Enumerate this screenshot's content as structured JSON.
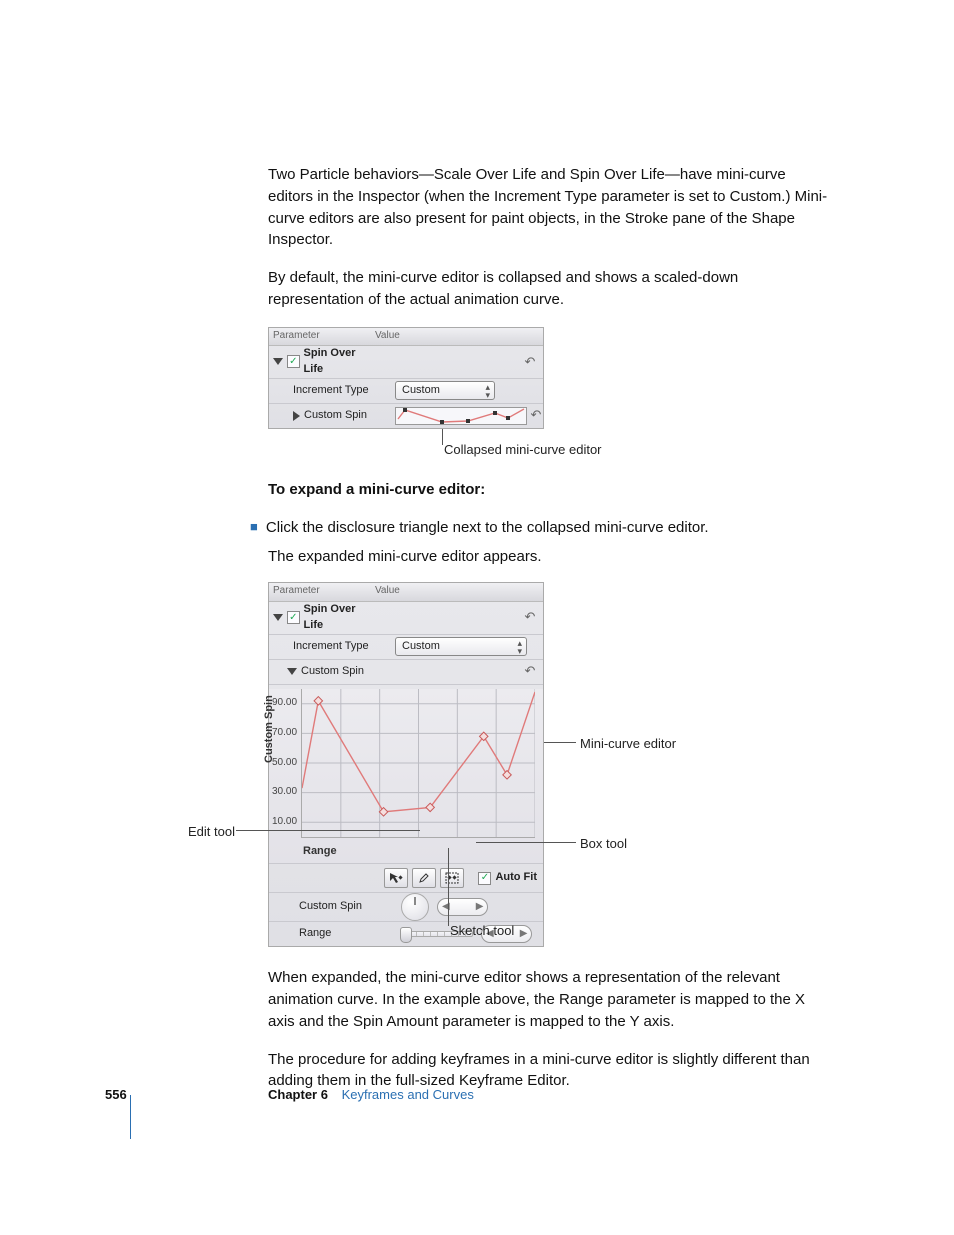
{
  "para1": "Two Particle behaviors—Scale Over Life and Spin Over Life—have mini-curve editors in the Inspector (when the Increment Type parameter is set to Custom.) Mini-curve editors are also present for paint objects, in the Stroke pane of the Shape Inspector.",
  "para2": "By default, the mini-curve editor is collapsed and shows a scaled-down representation of the actual animation curve.",
  "heading1": "To expand a mini-curve editor:",
  "step1": "Click the disclosure triangle next to the collapsed mini-curve editor.",
  "step1_result": "The expanded mini-curve editor appears.",
  "para3": "When expanded, the mini-curve editor shows a representation of the relevant animation curve. In the example above, the Range parameter is mapped to the X axis and the Spin Amount parameter is mapped to the Y axis.",
  "para4": "The procedure for adding keyframes in a mini-curve editor is slightly different than adding them in the full-sized Keyframe Editor.",
  "footer": {
    "page": "556",
    "chapter_label": "Chapter 6",
    "chapter_title": "Keyframes and Curves"
  },
  "panel_header": {
    "param": "Parameter",
    "value": "Value"
  },
  "fig1": {
    "row1_label": "Spin Over Life",
    "row2_label": "Increment Type",
    "row2_value": "Custom",
    "row3_label": "Custom Spin",
    "callout": "Collapsed mini-curve editor"
  },
  "fig2": {
    "row1_label": "Spin Over Life",
    "row2_label": "Increment Type",
    "row2_value": "Custom",
    "row3_label": "Custom Spin",
    "yaxis_title": "Custom Spin",
    "xaxis_title": "Range",
    "autofit": "Auto Fit",
    "row_spin": "Custom Spin",
    "row_range": "Range",
    "callout_mini": "Mini-curve editor",
    "callout_box": "Box tool",
    "callout_edit": "Edit tool",
    "callout_sketch": "Sketch tool"
  },
  "chart_data": {
    "type": "line",
    "xlabel": "Range",
    "ylabel": "Custom Spin",
    "ylim": [
      0,
      100
    ],
    "y_ticks": [
      10,
      30,
      50,
      70,
      90
    ],
    "y_tick_labels": [
      "10.00",
      "30.00",
      "50.00",
      "70.00",
      "90.00"
    ],
    "series": [
      {
        "name": "Custom Spin",
        "x": [
          0.0,
          0.07,
          0.35,
          0.55,
          0.78,
          0.88,
          1.0
        ],
        "values": [
          33,
          92,
          17,
          20,
          68,
          42,
          98
        ]
      }
    ]
  }
}
